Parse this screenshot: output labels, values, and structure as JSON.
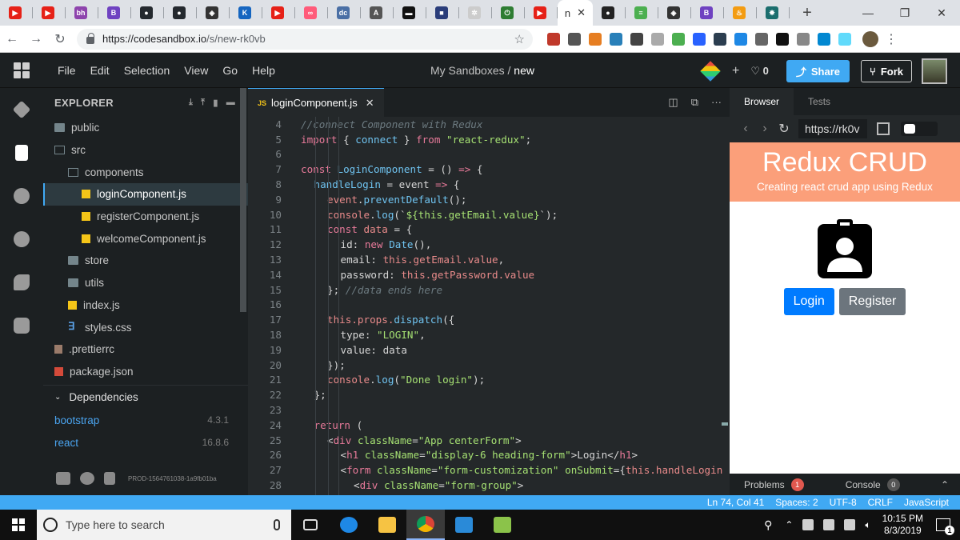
{
  "browser": {
    "active_tab_label": "n",
    "url_host": "https://codesandbox.io",
    "url_path": "/s/new-rk0vb",
    "tab_favicons": [
      "youtube",
      "youtube",
      "bh",
      "b",
      "github",
      "github",
      "codesandbox",
      "kcd",
      "youtube",
      "anchor",
      "dc",
      "a",
      "glasses",
      "square",
      "gear",
      "green",
      "youtube"
    ],
    "extensions": [
      "book",
      "circle",
      "megaphone",
      "box",
      "g",
      "pinwheel",
      "question",
      "cube",
      "terminal",
      "video",
      "q",
      "s",
      "circle-gray",
      "puzzle",
      "react"
    ]
  },
  "menubar": {
    "items": [
      "File",
      "Edit",
      "Selection",
      "View",
      "Go",
      "Help"
    ],
    "title_prefix": "My Sandboxes /",
    "title_name": "new",
    "likes": "0",
    "share_label": "Share",
    "fork_label": "Fork"
  },
  "explorer": {
    "header": "EXPLORER",
    "items": [
      {
        "label": "public",
        "icon": "folder",
        "indent": 0
      },
      {
        "label": "src",
        "icon": "folder-open",
        "indent": 0
      },
      {
        "label": "components",
        "icon": "folder-open",
        "indent": 1
      },
      {
        "label": "loginComponent.js",
        "icon": "js",
        "indent": 2,
        "selected": true
      },
      {
        "label": "registerComponent.js",
        "icon": "js",
        "indent": 2
      },
      {
        "label": "welcomeComponent.js",
        "icon": "js",
        "indent": 2
      },
      {
        "label": "store",
        "icon": "folder",
        "indent": 1
      },
      {
        "label": "utils",
        "icon": "folder",
        "indent": 1
      },
      {
        "label": "index.js",
        "icon": "js",
        "indent": 1
      },
      {
        "label": "styles.css",
        "icon": "css",
        "indent": 1
      },
      {
        "label": ".prettierrc",
        "icon": "prettier",
        "indent": 0
      },
      {
        "label": "package.json",
        "icon": "pkg",
        "indent": 0
      }
    ],
    "dependencies_label": "Dependencies",
    "dependencies": [
      {
        "name": "bootstrap",
        "version": "4.3.1"
      },
      {
        "name": "react",
        "version": "16.8.6"
      }
    ],
    "build_id": "PROD-1564761038-1a9fb01ba"
  },
  "editor": {
    "tab_badge": "JS",
    "tab_label": "loginComponent.js",
    "lines": [
      {
        "n": "4",
        "indent": 0,
        "tokens": [
          [
            "cm",
            "//connect Component with Redux"
          ]
        ]
      },
      {
        "n": "5",
        "indent": 0,
        "tokens": [
          [
            "kw",
            "import"
          ],
          [
            "plain",
            " { "
          ],
          [
            "fn",
            "connect"
          ],
          [
            "plain",
            " } "
          ],
          [
            "kw",
            "from"
          ],
          [
            "plain",
            " "
          ],
          [
            "str",
            "\"react-redux\""
          ],
          [
            "plain",
            ";"
          ]
        ]
      },
      {
        "n": "6",
        "indent": 0,
        "tokens": []
      },
      {
        "n": "7",
        "indent": 0,
        "tokens": [
          [
            "kw",
            "const"
          ],
          [
            "plain",
            " "
          ],
          [
            "fn",
            "LoginComponent"
          ],
          [
            "plain",
            " = () "
          ],
          [
            "kw",
            "=>"
          ],
          [
            "plain",
            " {"
          ]
        ]
      },
      {
        "n": "8",
        "indent": 1,
        "tokens": [
          [
            "fn",
            "handleLogin"
          ],
          [
            "plain",
            " = event "
          ],
          [
            "kw",
            "=>"
          ],
          [
            "plain",
            " {"
          ]
        ]
      },
      {
        "n": "9",
        "indent": 2,
        "tokens": [
          [
            "var",
            "event"
          ],
          [
            "plain",
            "."
          ],
          [
            "fn",
            "preventDefault"
          ],
          [
            "plain",
            "();"
          ]
        ]
      },
      {
        "n": "10",
        "indent": 2,
        "tokens": [
          [
            "var",
            "console"
          ],
          [
            "plain",
            "."
          ],
          [
            "fn",
            "log"
          ],
          [
            "plain",
            "(`"
          ],
          [
            "str",
            "${this.getEmail.value}"
          ],
          [
            "plain",
            "`);"
          ]
        ]
      },
      {
        "n": "11",
        "indent": 2,
        "tokens": [
          [
            "kw",
            "const"
          ],
          [
            "plain",
            " "
          ],
          [
            "var",
            "data"
          ],
          [
            "plain",
            " = {"
          ]
        ]
      },
      {
        "n": "12",
        "indent": 3,
        "tokens": [
          [
            "plain",
            "id: "
          ],
          [
            "kw",
            "new"
          ],
          [
            "plain",
            " "
          ],
          [
            "fn",
            "Date"
          ],
          [
            "plain",
            "(),"
          ]
        ]
      },
      {
        "n": "13",
        "indent": 3,
        "tokens": [
          [
            "plain",
            "email: "
          ],
          [
            "var",
            "this.getEmail.value"
          ],
          [
            "plain",
            ","
          ]
        ]
      },
      {
        "n": "14",
        "indent": 3,
        "tokens": [
          [
            "plain",
            "password: "
          ],
          [
            "var",
            "this.getPassword.value"
          ]
        ]
      },
      {
        "n": "15",
        "indent": 2,
        "tokens": [
          [
            "plain",
            "}; "
          ],
          [
            "cm",
            "//data ends here"
          ]
        ]
      },
      {
        "n": "16",
        "indent": 0,
        "tokens": []
      },
      {
        "n": "17",
        "indent": 2,
        "tokens": [
          [
            "var",
            "this.props."
          ],
          [
            "fn",
            "dispatch"
          ],
          [
            "plain",
            "({"
          ]
        ]
      },
      {
        "n": "18",
        "indent": 3,
        "tokens": [
          [
            "plain",
            "type: "
          ],
          [
            "str",
            "\"LOGIN\""
          ],
          [
            "plain",
            ","
          ]
        ]
      },
      {
        "n": "19",
        "indent": 3,
        "tokens": [
          [
            "plain",
            "value: data"
          ]
        ]
      },
      {
        "n": "20",
        "indent": 2,
        "tokens": [
          [
            "plain",
            "});"
          ]
        ]
      },
      {
        "n": "21",
        "indent": 2,
        "tokens": [
          [
            "var",
            "console"
          ],
          [
            "plain",
            "."
          ],
          [
            "fn",
            "log"
          ],
          [
            "plain",
            "("
          ],
          [
            "str",
            "\"Done login\""
          ],
          [
            "plain",
            ");"
          ]
        ]
      },
      {
        "n": "22",
        "indent": 1,
        "tokens": [
          [
            "plain",
            "};"
          ]
        ]
      },
      {
        "n": "23",
        "indent": 0,
        "tokens": []
      },
      {
        "n": "24",
        "indent": 1,
        "tokens": [
          [
            "kw",
            "return"
          ],
          [
            "plain",
            " ("
          ]
        ]
      },
      {
        "n": "25",
        "indent": 2,
        "tokens": [
          [
            "plain",
            "<"
          ],
          [
            "tag",
            "div"
          ],
          [
            "plain",
            " "
          ],
          [
            "attr",
            "className"
          ],
          [
            "plain",
            "="
          ],
          [
            "str",
            "\"App centerForm\""
          ],
          [
            "plain",
            ">"
          ]
        ]
      },
      {
        "n": "26",
        "indent": 3,
        "tokens": [
          [
            "plain",
            "<"
          ],
          [
            "tag",
            "h1"
          ],
          [
            "plain",
            " "
          ],
          [
            "attr",
            "className"
          ],
          [
            "plain",
            "="
          ],
          [
            "str",
            "\"display-6 heading-form\""
          ],
          [
            "plain",
            ">Login</"
          ],
          [
            "tag",
            "h1"
          ],
          [
            "plain",
            ">"
          ]
        ]
      },
      {
        "n": "27",
        "indent": 3,
        "tokens": [
          [
            "plain",
            "<"
          ],
          [
            "tag",
            "form"
          ],
          [
            "plain",
            " "
          ],
          [
            "attr",
            "className"
          ],
          [
            "plain",
            "="
          ],
          [
            "str",
            "\"form-customization\""
          ],
          [
            "plain",
            " "
          ],
          [
            "attr",
            "onSubmit"
          ],
          [
            "plain",
            "={"
          ],
          [
            "var",
            "this.handleLogin"
          ]
        ]
      },
      {
        "n": "28",
        "indent": 4,
        "tokens": [
          [
            "plain",
            "<"
          ],
          [
            "tag",
            "div"
          ],
          [
            "plain",
            " "
          ],
          [
            "attr",
            "className"
          ],
          [
            "plain",
            "="
          ],
          [
            "str",
            "\"form-group\""
          ],
          [
            "plain",
            ">"
          ]
        ]
      }
    ]
  },
  "preview": {
    "tabs": [
      "Browser",
      "Tests"
    ],
    "url": "https://rk0v",
    "app_title": "Redux CRUD",
    "app_subtitle": "Creating react crud app using Redux",
    "login_label": "Login",
    "register_label": "Register",
    "problems_label": "Problems",
    "problems_count": "1",
    "console_label": "Console",
    "console_count": "0"
  },
  "statusbar": {
    "position": "Ln 74, Col 41",
    "spaces": "Spaces: 2",
    "encoding": "UTF-8",
    "eol": "CRLF",
    "language": "JavaScript"
  },
  "taskbar": {
    "search_placeholder": "Type here to search",
    "time": "10:15 PM",
    "date": "8/3/2019",
    "notification_count": "1"
  },
  "colors": {
    "accent": "#40a9f3",
    "hero": "#fb9f7a",
    "login_btn": "#007bff",
    "register_btn": "#6c757d"
  }
}
